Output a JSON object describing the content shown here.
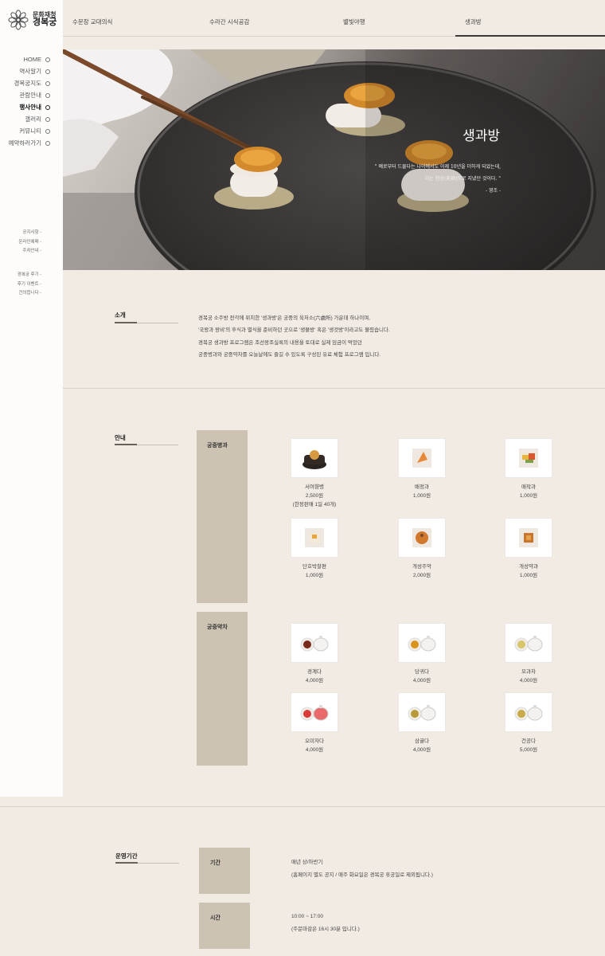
{
  "logo": {
    "line1": "문화재청",
    "line2": "경복궁"
  },
  "sidebar": {
    "items": [
      {
        "label": "HOME"
      },
      {
        "label": "역사알기"
      },
      {
        "label": "경복궁지도"
      },
      {
        "label": "관람안내"
      },
      {
        "label": "행사안내",
        "active": true
      },
      {
        "label": "갤러리"
      },
      {
        "label": "커뮤니티"
      },
      {
        "label": "예약하러가기"
      }
    ],
    "sub1": [
      "공지사항 -",
      "온라인예매 -",
      "주차안내 -"
    ],
    "sub2": [
      "경복궁 후기 -",
      "후기 이벤트 -",
      "건의합니다 -"
    ]
  },
  "topnav": {
    "tabs": [
      {
        "label": "수문장 교대의식"
      },
      {
        "label": "수라간 시식공감"
      },
      {
        "label": "별빛야행"
      },
      {
        "label": "생과방",
        "active": true
      }
    ]
  },
  "hero": {
    "title": "생과방",
    "quote_line1": "\" 예로부터 드물다는 나이에서도 이제 10년을 더하게 되었는데,",
    "quote_line2": "이는 천공(天供)으로 지냈던 것이다. \"",
    "quote_author": "- 영조 -"
  },
  "intro": {
    "label": "소개",
    "lines": [
      "경복궁 소주방 전각에 위치한 '생과방'은 궁중의 육처소(六處所) 가운데 하나이며,",
      "'국왕과 왕비'의 후식과 별식을 준비하던 곳으로 '생물방' 혹은 '생것방'이라고도 불렸습니다.",
      "경복궁 생과방 프로그램은 조선왕조실록의 내용을 토대로 실제 임금이 먹었던",
      "궁중병과와 궁중약차를 오늘날에도 즐길 수 있도록 구성된 유료 체험 프로그램 입니다."
    ]
  },
  "guide": {
    "label": "안내",
    "categories": [
      {
        "name": "궁중병과",
        "items": [
          {
            "name": "서여향병",
            "price": "2,500원",
            "note": "(한정판매 1일 40개)"
          },
          {
            "name": "배정과",
            "price": "1,000원"
          },
          {
            "name": "매작과",
            "price": "1,000원"
          },
          {
            "name": "단호박찰편",
            "price": "1,000원"
          },
          {
            "name": "개성주악",
            "price": "2,000원"
          },
          {
            "name": "개성약과",
            "price": "1,000원"
          }
        ]
      },
      {
        "name": "궁중약차",
        "items": [
          {
            "name": "경계다",
            "price": "4,000원"
          },
          {
            "name": "당귀다",
            "price": "4,000원"
          },
          {
            "name": "모과차",
            "price": "4,000원"
          },
          {
            "name": "오미자다",
            "price": "4,000원"
          },
          {
            "name": "삼귤다",
            "price": "4,000원"
          },
          {
            "name": "건공다",
            "price": "5,000원"
          }
        ]
      }
    ]
  },
  "operation": {
    "label": "운영기간",
    "rows": [
      {
        "title": "기간",
        "line1": "매년 상/하반기",
        "line2": "(홈페이지 별도 공지 / 매주 화요일은 경복궁 휴궁일로 제외됩니다.)"
      },
      {
        "title": "시간",
        "line1": "10:00 ~ 17:00",
        "line2": "(주문마감은 16시 30분 입니다.)"
      }
    ]
  },
  "colors": {
    "background": "#f2ebe4",
    "sidebar": "#fdfcfb",
    "category_box": "#cdc3b3",
    "accent_dark": "#3a3a3a"
  }
}
